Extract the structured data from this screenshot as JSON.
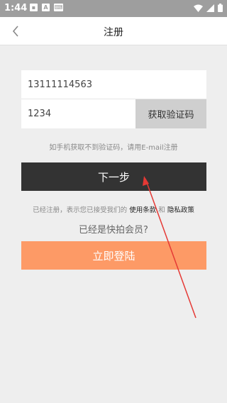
{
  "status_bar": {
    "time": "1:44",
    "left_icons": [
      "image-icon",
      "a-icon",
      "keyboard-icon"
    ],
    "right_icons": [
      "wifi-icon",
      "signal-icon",
      "battery-icon"
    ]
  },
  "app_bar": {
    "title": "注册",
    "back_icon": "chevron-left-icon"
  },
  "form": {
    "phone_value": "13111114563",
    "code_value": "1234",
    "get_code_label": "获取验证码",
    "hint": "如手机获取不到验证码，请用E-mail注册",
    "next_label": "下一步"
  },
  "terms": {
    "prefix": "已经注册，表示您已接受我们的",
    "link1": "使用条款",
    "and": "和",
    "link2": "隐私政策"
  },
  "member": {
    "question": "已经是快拍会员?",
    "login_label": "立即登陆"
  },
  "colors": {
    "status_bar": "#9e9e9e",
    "next_button": "#333333",
    "login_button": "#fd9a66",
    "get_code_button": "#cfcfcf",
    "annotation_arrow": "#e53935"
  }
}
